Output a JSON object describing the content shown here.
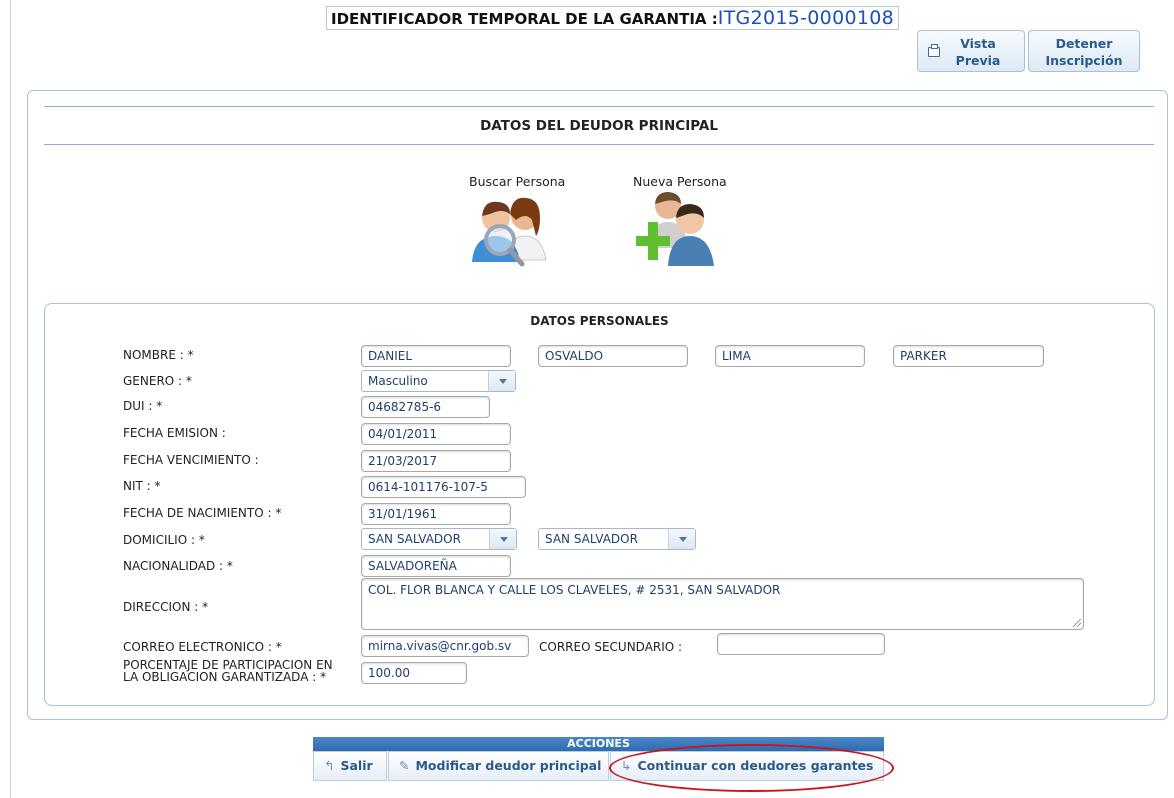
{
  "header": {
    "label": "IDENTIFICADOR TEMPORAL DE LA GARANTIA :",
    "identifier": "ITG2015-0000108"
  },
  "toolbar": {
    "preview_label_1": "Vista",
    "preview_label_2": "Previa",
    "stop_label_1": "Detener",
    "stop_label_2": "Inscripción"
  },
  "section": {
    "title": "DATOS DEL DEUDOR PRINCIPAL"
  },
  "person_actions": {
    "search_label": "Buscar Persona",
    "new_label": "Nueva Persona"
  },
  "personal": {
    "title": "DATOS PERSONALES",
    "labels": {
      "nombre": "NOMBRE :  *",
      "genero": "GENERO :  *",
      "dui": "DUI :  *",
      "fecha_emision": "FECHA EMISION :",
      "fecha_vencimiento": "FECHA VENCIMIENTO :",
      "nit": "NIT :  *",
      "fecha_nacimiento": "FECHA DE NACIMIENTO :  *",
      "domicilio": "DOMICILIO :  *",
      "nacionalidad": "NACIONALIDAD :  *",
      "direccion": "DIRECCION :  *",
      "correo": "CORREO ELECTRONICO :  *",
      "correo_secundario": "CORREO SECUNDARIO :",
      "porcentaje_1": "PORCENTAJE DE PARTICIPACION EN",
      "porcentaje_2": "LA OBLIGACION GARANTIZADA :  *"
    },
    "values": {
      "nombre1": "DANIEL",
      "nombre2": "OSVALDO",
      "apellido1": "LIMA",
      "apellido2": "PARKER",
      "genero": "Masculino",
      "dui": "04682785-6",
      "fecha_emision": "04/01/2011",
      "fecha_vencimiento": "21/03/2017",
      "nit": "0614-101176-107-5",
      "fecha_nacimiento": "31/01/1961",
      "departamento": "SAN SALVADOR",
      "municipio": "SAN SALVADOR",
      "nacionalidad": "SALVADOREÑA",
      "direccion": "COL. FLOR BLANCA Y CALLE LOS CLAVELES, # 2531, SAN SALVADOR",
      "correo": "mirna.vivas@cnr.gob.sv",
      "correo_secundario": "",
      "porcentaje": "100.00"
    }
  },
  "actions": {
    "title": "ACCIONES",
    "exit_label": "Salir",
    "modify_label": "Modificar deudor principal",
    "continue_label": "Continuar con deudores garantes"
  },
  "colors": {
    "accent": "#1c4fb8",
    "button_text": "#2a5a8a",
    "actions_bar": "#2f6cb0",
    "highlight_oval": "#c8161d"
  }
}
